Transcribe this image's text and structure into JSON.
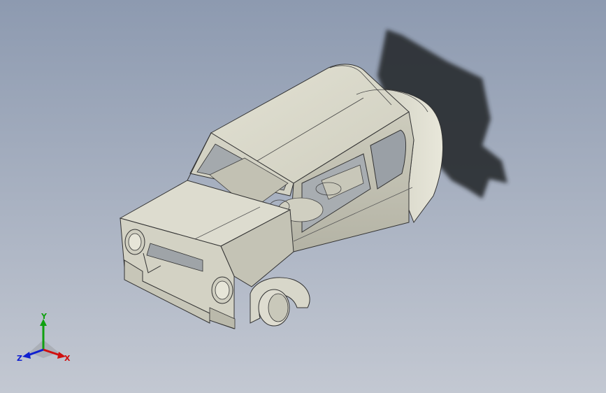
{
  "viewport": {
    "background_top": "#8d9ab0",
    "background_bottom": "#c3c8d2",
    "model_body_color": "#d9d8c9",
    "model_shade_color": "#b9b8aa",
    "shadow_color": "#2c2f33"
  },
  "triad": {
    "x_label": "X",
    "y_label": "Y",
    "z_label": "Z",
    "x_color": "#d01010",
    "y_color": "#10a010",
    "z_color": "#1020d0"
  }
}
